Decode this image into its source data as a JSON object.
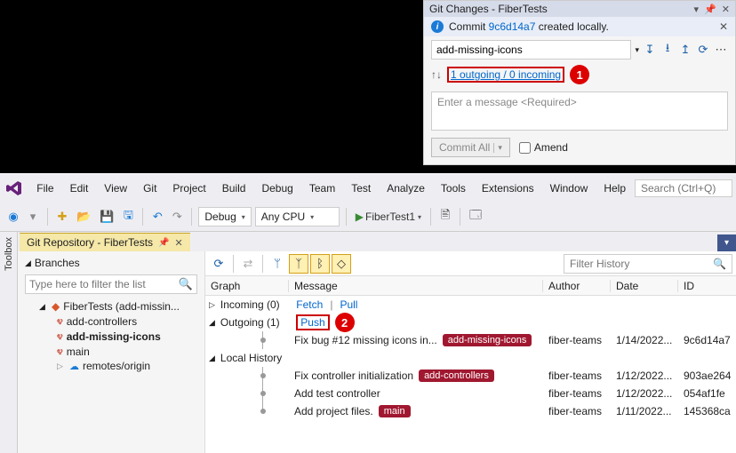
{
  "git_changes": {
    "title": "Git Changes - FiberTests",
    "info_prefix": "Commit ",
    "commit_hash": "9c6d14a7",
    "info_suffix": " created locally.",
    "branch": "add-missing-icons",
    "sync_text": "1 outgoing / 0 incoming",
    "message_placeholder": "Enter a message <Required>",
    "commit_btn": "Commit All",
    "amend_label": "Amend"
  },
  "menu": [
    "File",
    "Edit",
    "View",
    "Git",
    "Project",
    "Build",
    "Debug",
    "Team",
    "Test",
    "Analyze",
    "Tools",
    "Extensions",
    "Window",
    "Help"
  ],
  "search_placeholder": "Search (Ctrl+Q)",
  "toolbar": {
    "config": "Debug",
    "platform": "Any CPU",
    "start": "FiberTest1"
  },
  "repo_tab": "Git Repository - FiberTests",
  "toolbox_label": "Toolbox",
  "sidebar": {
    "header": "Branches",
    "filter_placeholder": "Type here to filter the list",
    "root": "FiberTests (add-missin...",
    "branches": [
      "add-controllers",
      "add-missing-icons",
      "main"
    ],
    "remotes": "remotes/origin"
  },
  "graph": {
    "filter_placeholder": "Filter History",
    "cols": {
      "graph": "Graph",
      "msg": "Message",
      "author": "Author",
      "date": "Date",
      "id": "ID"
    },
    "incoming_label": "Incoming (0)",
    "fetch": "Fetch",
    "pull": "Pull",
    "outgoing_label": "Outgoing (1)",
    "push": "Push",
    "local_history": "Local History",
    "rows": [
      {
        "msg": "Fix bug #12 missing icons in...",
        "badge": "add-missing-icons",
        "author": "fiber-teams",
        "date": "1/14/2022...",
        "id": "9c6d14a7"
      },
      {
        "msg": "Fix controller initialization",
        "badge": "add-controllers",
        "author": "fiber-teams",
        "date": "1/12/2022...",
        "id": "903ae264"
      },
      {
        "msg": "Add test controller",
        "badge": "",
        "author": "fiber-teams",
        "date": "1/12/2022...",
        "id": "054af1fe"
      },
      {
        "msg": "Add project files.",
        "badge": "main",
        "author": "fiber-teams",
        "date": "1/11/2022...",
        "id": "145368ca"
      }
    ]
  },
  "callouts": {
    "one": "1",
    "two": "2"
  }
}
